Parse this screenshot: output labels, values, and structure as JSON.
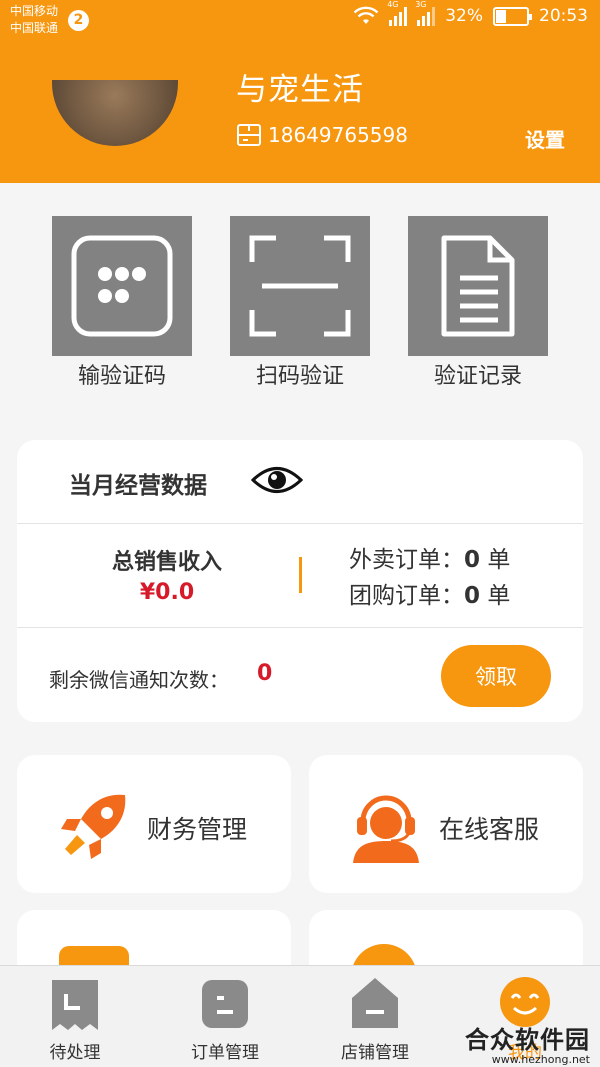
{
  "status_bar": {
    "carrier_1": "中国移动",
    "carrier_2": "中国联通",
    "notification_count": "2",
    "network_1": "4G",
    "network_2": "3G",
    "battery": "32%",
    "battery_level": 0.32,
    "time": "20:53"
  },
  "header": {
    "store_name": "与宠生活",
    "phone": "18649765598",
    "settings_label": "设置",
    "bg_color": "#f7960f"
  },
  "actions": [
    {
      "label": "输验证码",
      "icon": "keypad-icon"
    },
    {
      "label": "扫码验证",
      "icon": "scan-icon"
    },
    {
      "label": "验证记录",
      "icon": "document-icon"
    }
  ],
  "monthly": {
    "title": "当月经营数据",
    "sales_label": "总销售收入",
    "sales_value": "¥0.0",
    "takeout_label": "外卖订单：",
    "takeout_count": "0",
    "group_label": "团购订单：",
    "group_count": "0",
    "unit": "单",
    "wechat_label": "剩余微信通知次数：",
    "wechat_count": "0",
    "claim_button": "领取"
  },
  "services": [
    {
      "label": "财务管理",
      "icon": "rocket-icon"
    },
    {
      "label": "在线客服",
      "icon": "headset-agent-icon"
    }
  ],
  "tabs": [
    {
      "label": "待处理",
      "icon": "pending-icon"
    },
    {
      "label": "订单管理",
      "icon": "order-icon"
    },
    {
      "label": "店铺管理",
      "icon": "store-icon"
    },
    {
      "label": "我的",
      "icon": "smiley-icon"
    }
  ],
  "watermark": {
    "name": "合众软件园",
    "url": "www.hezhong.net"
  },
  "colors": {
    "accent": "#f7960f",
    "price_red": "#d61a2a",
    "tile_gray": "#828282"
  }
}
